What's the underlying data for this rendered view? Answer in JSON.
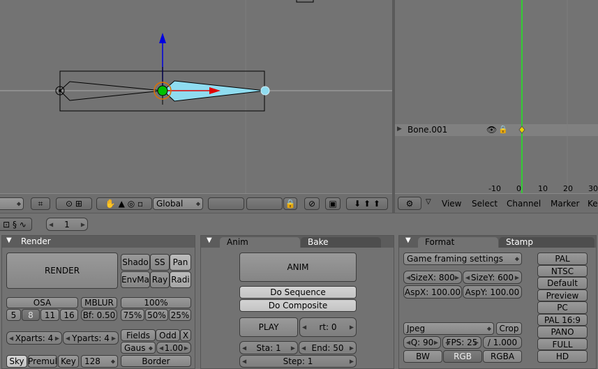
{
  "view3d": {
    "orientation": "Global",
    "header_icons": [
      "view-menu-icon",
      "object-mode-icon",
      "magnet-icon",
      "layers-icon",
      "hand-icon",
      "translate-icon",
      "rotate-icon",
      "scale-icon",
      "lock-icon",
      "camera-icon",
      "render-icon",
      "onion-skin-icons"
    ]
  },
  "action_editor": {
    "channel_name": "Bone.001",
    "ruler_labels": [
      "-10",
      "0",
      "10",
      "20",
      "30"
    ],
    "menus": [
      "View",
      "Select",
      "Channel",
      "Marker",
      "Ke"
    ]
  },
  "buttons_header": {
    "frame_value": "1"
  },
  "render_panel": {
    "title": "Render",
    "render_button": "RENDER",
    "shadow": "Shado",
    "ss": "SS",
    "pan": "Pan",
    "envmap": "EnvMa",
    "ray": "Ray",
    "radio": "Radi",
    "osa": "OSA",
    "osa_levels": [
      "5",
      "8",
      "11",
      "16"
    ],
    "mblur": "MBLUR",
    "bf": "Bf: 0.50",
    "percent_100": "100%",
    "percent_options": [
      "75%",
      "50%",
      "25%"
    ],
    "xparts": "Xparts: 4",
    "yparts": "Yparts: 4",
    "fields": "Fields",
    "odd": "Odd",
    "x": "X",
    "gaus": "Gaus",
    "gaus_value": "1.00",
    "sky": "Sky",
    "premul": "Premul",
    "key": "Key",
    "bits": "128",
    "border": "Border"
  },
  "anim_panel": {
    "tabs": [
      "Anim",
      "Bake"
    ],
    "anim_button": "ANIM",
    "do_sequence": "Do Sequence",
    "do_composite": "Do Composite",
    "play": "PLAY",
    "rt": "rt: 0",
    "sta": "Sta: 1",
    "end": "End: 50",
    "step": "Step: 1"
  },
  "format_panel": {
    "tabs": [
      "Format",
      "Stamp"
    ],
    "preset": "Game framing settings",
    "sizex": "SizeX: 800",
    "sizey": "SizeY: 600",
    "aspx": "AspX: 100.00",
    "aspy": "AspY: 100.00",
    "format": "Jpeg",
    "crop": "Crop",
    "quality": "Q: 90",
    "fps": "FPS: 25",
    "fps_base": "/ 1.000",
    "bw": "BW",
    "rgb": "RGB",
    "rgba": "RGBA",
    "presets": [
      "PAL",
      "NTSC",
      "Default",
      "Preview",
      "PC",
      "PAL 16:9",
      "PANO",
      "FULL",
      "HD"
    ]
  },
  "colors": {
    "bone_selected": "#8fdcf0",
    "x_axis": "#e00000",
    "y_axis": "#00c000",
    "z_axis": "#0000e0",
    "frame_line": "#33cc33",
    "keyframe": "#e8d000"
  }
}
